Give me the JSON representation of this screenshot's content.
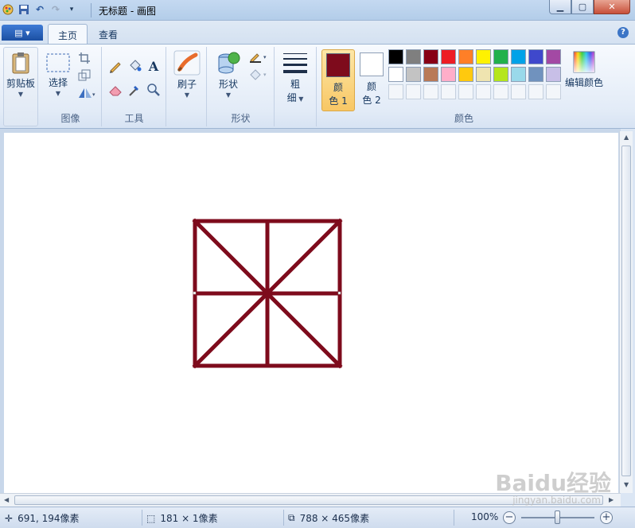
{
  "window": {
    "title": "无标题 - 画图"
  },
  "tabs": {
    "app_menu": "▤ ▾",
    "home": "主页",
    "view": "查看"
  },
  "ribbon": {
    "clipboard": {
      "label": "剪贴板"
    },
    "image": {
      "select": "选择",
      "group": "图像"
    },
    "tools": {
      "group": "工具"
    },
    "brushes": {
      "label": "刷子"
    },
    "shapes": {
      "label": "形状",
      "group": "形状"
    },
    "size": {
      "label1": "粗",
      "label2": "细"
    },
    "colors": {
      "color1_a": "颜",
      "color1_b": "色 1",
      "color2_a": "颜",
      "color2_b": "色 2",
      "color1_value": "#7e0b1c",
      "color2_value": "#ffffff",
      "edit": "编辑颜色",
      "group": "颜色",
      "palette_row1": [
        "#000000",
        "#7f7f7f",
        "#880015",
        "#ed1c24",
        "#ff7f27",
        "#fff200",
        "#22b14c",
        "#00a2e8",
        "#3f48cc",
        "#a349a4"
      ],
      "palette_row2": [
        "#ffffff",
        "#c3c3c3",
        "#b97a57",
        "#ffaec9",
        "#ffc90e",
        "#efe4b0",
        "#b5e61d",
        "#99d9ea",
        "#7092be",
        "#c8bfe7"
      ]
    }
  },
  "status": {
    "cursor": "691, 194像素",
    "selection": "181 × 1像素",
    "canvas_size": "788 × 465像素",
    "zoom": "100%"
  },
  "drawing": {
    "stroke_color": "#7e0b1c"
  },
  "watermark": {
    "brand": "Baidu经验",
    "url": "jingyan.baidu.com"
  }
}
